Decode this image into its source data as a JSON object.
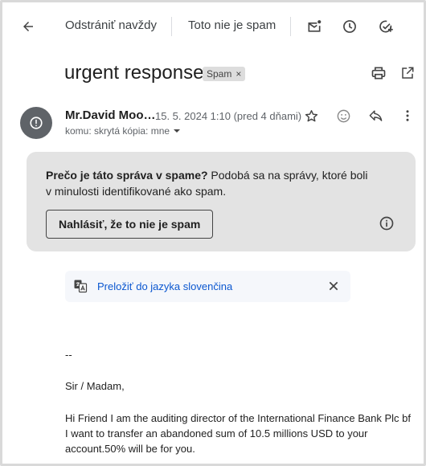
{
  "toolbar": {
    "delete_forever_label": "Odstrániť navždy",
    "not_spam_label": "Toto nie je spam"
  },
  "message": {
    "subject": "urgent response",
    "label_chip": "Spam",
    "chip_close": "×",
    "sender_name": "Mr.David Moo…",
    "date": "15. 5. 2024 1:10 (pred 4 dňami)",
    "recipients": "komu: skrytá kópia: mne"
  },
  "spam_warning": {
    "question": "Prečo je táto správa v spame?",
    "explanation_line1": " Podobá sa na správy, ktoré boli",
    "explanation_line2": "v minulosti identifikované ako spam.",
    "report_button": "Nahlásiť, že to nie je spam"
  },
  "translate": {
    "link": "Preložiť do jazyka slovenčina"
  },
  "body": {
    "signature_sep": "--",
    "greeting": "Sir / Madam,",
    "line1": "Hi Friend I am the auditing director of the International Finance Bank Plc bf",
    "line2": "I want to transfer an abandoned sum of 10.5 millions USD  to your",
    "line3": "account.50% will be for you."
  },
  "colors": {
    "accent": "#0b57d0",
    "warning_bg": "#e3e3e3",
    "avatar_bg": "#5f6368"
  }
}
